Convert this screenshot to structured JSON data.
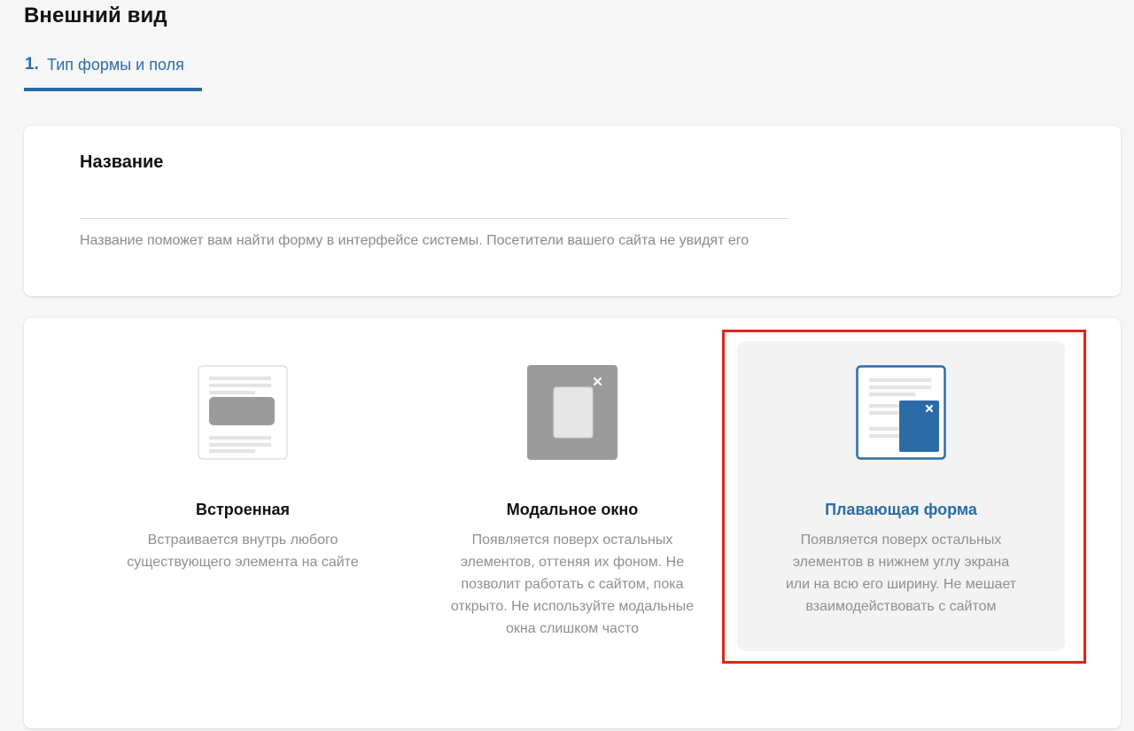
{
  "page": {
    "title": "Внешний вид"
  },
  "steps": [
    {
      "number": "1.",
      "label": "Тип формы и поля",
      "active": true
    }
  ],
  "name_card": {
    "label": "Название",
    "input_value": "",
    "hint": "Название поможет вам найти форму в интерфейсе системы. Посетители вашего сайта не увидят его"
  },
  "form_types": {
    "selected": "floating",
    "options": [
      {
        "id": "embedded",
        "icon": "embedded-form-icon",
        "title": "Встроенная",
        "description": "Встраивается внутрь любого существующего элемента на сайте"
      },
      {
        "id": "modal",
        "icon": "modal-window-icon",
        "title": "Модальное окно",
        "description": "Появляется поверх остальных элементов, оттеняя их фоном. Не позволит работать с сайтом, пока открыто. Не используйте модальные окна слишком часто"
      },
      {
        "id": "floating",
        "icon": "floating-form-icon",
        "title": "Плавающая форма",
        "description": "Появляется поверх остальных элементов в нижнем углу экрана или на всю его ширину. Не мешает взаимодействовать с сайтом"
      }
    ]
  },
  "colors": {
    "accent": "#2a6ca8",
    "highlight": "#e0261b",
    "muted_text": "#8f8f8f",
    "background": "#f6f6f6"
  }
}
